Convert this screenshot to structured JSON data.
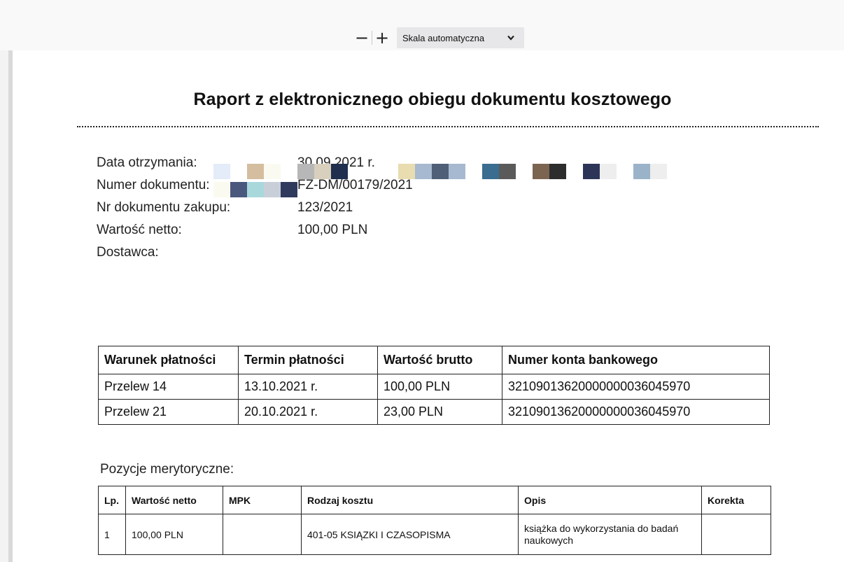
{
  "toolbar": {
    "zoom_out_label": "−",
    "zoom_in_label": "+",
    "scale_value": "Skala automatyczna",
    "dropdown_icon": "chevron-down-icon"
  },
  "document": {
    "title": "Raport z elektronicznego obiegu dokumentu kosztowego",
    "fields": [
      {
        "label": "Data otrzymania:",
        "value": "30.09.2021 r."
      },
      {
        "label": "Numer dokumentu:",
        "value": "FZ-DM/00179/2021"
      },
      {
        "label": "Nr dokumentu zakupu:",
        "value": "123/2021"
      },
      {
        "label": "Wartość netto:",
        "value": "100,00 PLN"
      },
      {
        "label": "Dostawca:",
        "value": ""
      }
    ],
    "payments": {
      "headers": [
        "Warunek płatności",
        "Termin płatności",
        "Wartość brutto",
        "Numer konta bankowego"
      ],
      "rows": [
        [
          "Przelew 14",
          "13.10.2021 r.",
          "100,00 PLN",
          "32109013620000000036045970"
        ],
        [
          "Przelew 21",
          "20.10.2021 r.",
          "23,00 PLN",
          "32109013620000000036045970"
        ]
      ]
    },
    "positions_title": "Pozycje merytoryczne:",
    "positions": {
      "headers": [
        "Lp.",
        "Wartość netto",
        "MPK",
        "Rodzaj kosztu",
        "Opis",
        "Korekta"
      ],
      "rows": [
        [
          "1",
          "100,00 PLN",
          "",
          "401-05 KSIĄZKI I CZASOPISMA",
          "książka do wykorzystania do badań naukowych",
          ""
        ]
      ]
    }
  },
  "colors": {
    "toolbar_bg": "#f9f9fa",
    "select_bg": "#e7e7e9",
    "redaction_palette": [
      "#e3ecf8",
      "#d4be9f",
      "#fbfaf0",
      "#b7b7b7",
      "#d8cfbd",
      "#1f2f4d",
      "#e8dcb0",
      "#a7b9d0",
      "#4f5f78",
      "#3a6d8f",
      "#5a5a5a",
      "#7b6551",
      "#2d2d2d",
      "#2c3558",
      "#eeeeee",
      "#9ab3c8",
      "#4b587e",
      "#a8d8dc",
      "#c9cfd9",
      "#303a5c"
    ]
  }
}
